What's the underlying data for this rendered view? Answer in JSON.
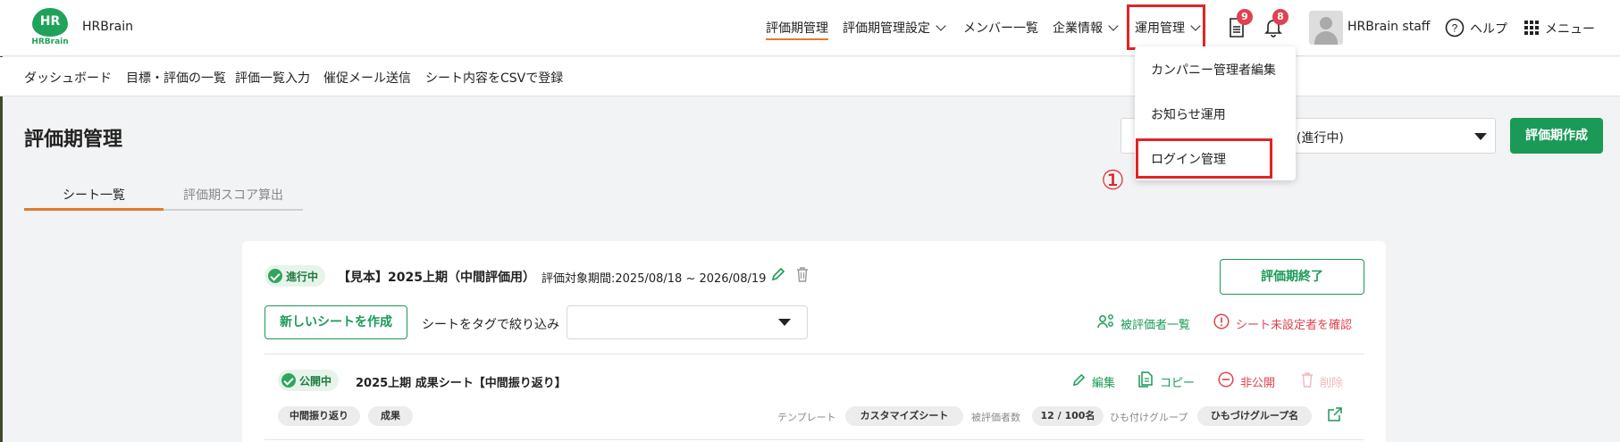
{
  "header": {
    "logo_text": "HR",
    "logo_sub": "HRBrain",
    "brand": "HRBrain",
    "nav": [
      "評価期管理",
      "評価期管理設定",
      "メンバー一覧",
      "企業情報",
      "運用管理"
    ],
    "doc_badge": "9",
    "bell_badge": "8",
    "user": "HRBrain staff",
    "help": "ヘルプ",
    "menu": "メニュー"
  },
  "subnav": [
    "ダッシュボード",
    "目標・評価の一覧",
    "評価一覧入力",
    "催促メール送信",
    "シート内容をCSVで登録"
  ],
  "dropdown": {
    "items": [
      "カンパニー管理者編集",
      "お知らせ運用",
      "ログイン管理"
    ],
    "annotation": "①"
  },
  "page": {
    "title": "評価期管理",
    "period_select_text": "月) (進行中)",
    "create_button": "評価期作成",
    "tabs": [
      "シート一覧",
      "評価期スコア算出"
    ]
  },
  "period": {
    "status": "進行中",
    "title": "【見本】2025上期（中間評価用）",
    "range": "評価対象期間:2025/08/18 ~ 2026/08/19",
    "end_button": "評価期終了",
    "new_sheet_button": "新しいシートを作成",
    "tag_filter_label": "シートをタグで絞り込み",
    "evaluatee_list": "被評価者一覧",
    "unset_check": "シート未設定者を確認"
  },
  "sheet": {
    "status": "公開中",
    "title": "2025上期 成果シート【中間振り返り】",
    "actions": [
      "編集",
      "コピー",
      "非公開",
      "削除"
    ],
    "tags": [
      "中間振り返り",
      "成果"
    ],
    "template_label": "テンプレート",
    "template_value": "カスタマイズシート",
    "evaluatee_count_label": "被評価者数",
    "evaluatee_count_value": "12 / 100名",
    "group_label": "ひも付けグループ",
    "group_value": "ひもづけグループ名"
  },
  "colors": {
    "accent_green": "#1a9a56",
    "alert_red": "#e0424f",
    "highlight_box": "#e12424",
    "tab_underline": "#e07a2e"
  }
}
